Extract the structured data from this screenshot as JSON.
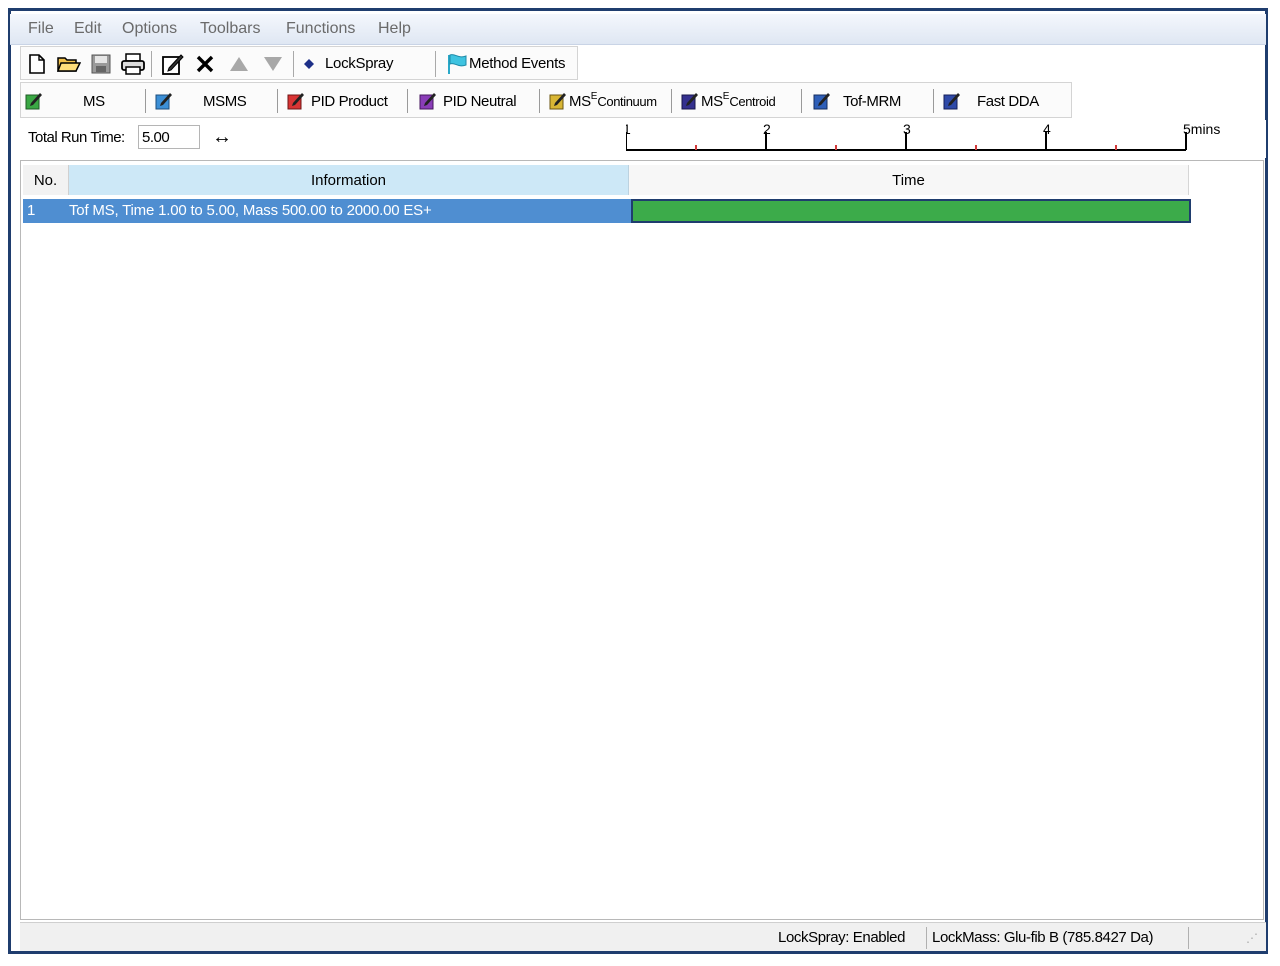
{
  "menu": [
    "File",
    "Edit",
    "Options",
    "Toolbars",
    "Functions",
    "Help"
  ],
  "toolbar": {
    "icons": [
      "new-icon",
      "open-icon",
      "save-icon",
      "print-icon",
      "edit-icon",
      "delete-icon",
      "move-up-icon",
      "move-down-icon"
    ],
    "lockspray_label": "LockSpray",
    "method_events_label": "Method Events"
  },
  "functions": [
    {
      "label": "MS",
      "color": "#3aa844"
    },
    {
      "label": "MSMS",
      "color": "#3c8fd6"
    },
    {
      "label": "PID Product",
      "color": "#d93434"
    },
    {
      "label": "PID Neutral",
      "color": "#8a3db8"
    },
    {
      "label": "MS",
      "sup": "E",
      "suffix": " Continuum",
      "color": "#d9b634"
    },
    {
      "label": "MS",
      "sup": "E",
      "suffix": " Centroid",
      "color": "#34308f"
    },
    {
      "label": "Tof-MRM",
      "color": "#2f5fb8"
    },
    {
      "label": "Fast DDA",
      "color": "#2f4aa8"
    }
  ],
  "run": {
    "label": "Total Run Time:",
    "value": "5.00",
    "ruler_ticks": [
      "1",
      "2",
      "3",
      "4",
      "5mins"
    ],
    "ruler_min": 1,
    "ruler_max": 5
  },
  "grid": {
    "headers": {
      "no": "No.",
      "information": "Information",
      "time": "Time"
    },
    "rows": [
      {
        "no": "1",
        "info": "Tof MS, Time 1.00 to 5.00, Mass 500.00 to 2000.00 ES+",
        "start": 1.0,
        "end": 5.0
      }
    ]
  },
  "status": {
    "lockspray": "LockSpray: Enabled",
    "lockmass": "LockMass: Glu-fib B (785.8427 Da)"
  }
}
